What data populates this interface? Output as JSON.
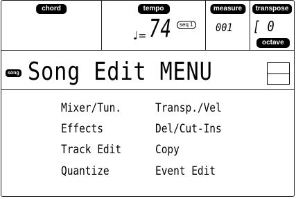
{
  "header": {
    "chord_label": "chord",
    "tempo_label": "tempo",
    "tempo_note": "♩=",
    "tempo_value": "74",
    "tempo_source": "seq 1",
    "measure_label": "measure",
    "measure_value": "001",
    "transpose_label": "transpose",
    "transpose_value": "[ 0",
    "octave_label": "octave"
  },
  "titlebar": {
    "mode_label": "song",
    "title": "Song Edit MENU"
  },
  "menu": {
    "items": [
      "Mixer/Tun.",
      "Transp./Vel",
      "Effects",
      "Del/Cut-Ins",
      "Track Edit",
      "Copy",
      "Quantize",
      "Event Edit"
    ]
  }
}
